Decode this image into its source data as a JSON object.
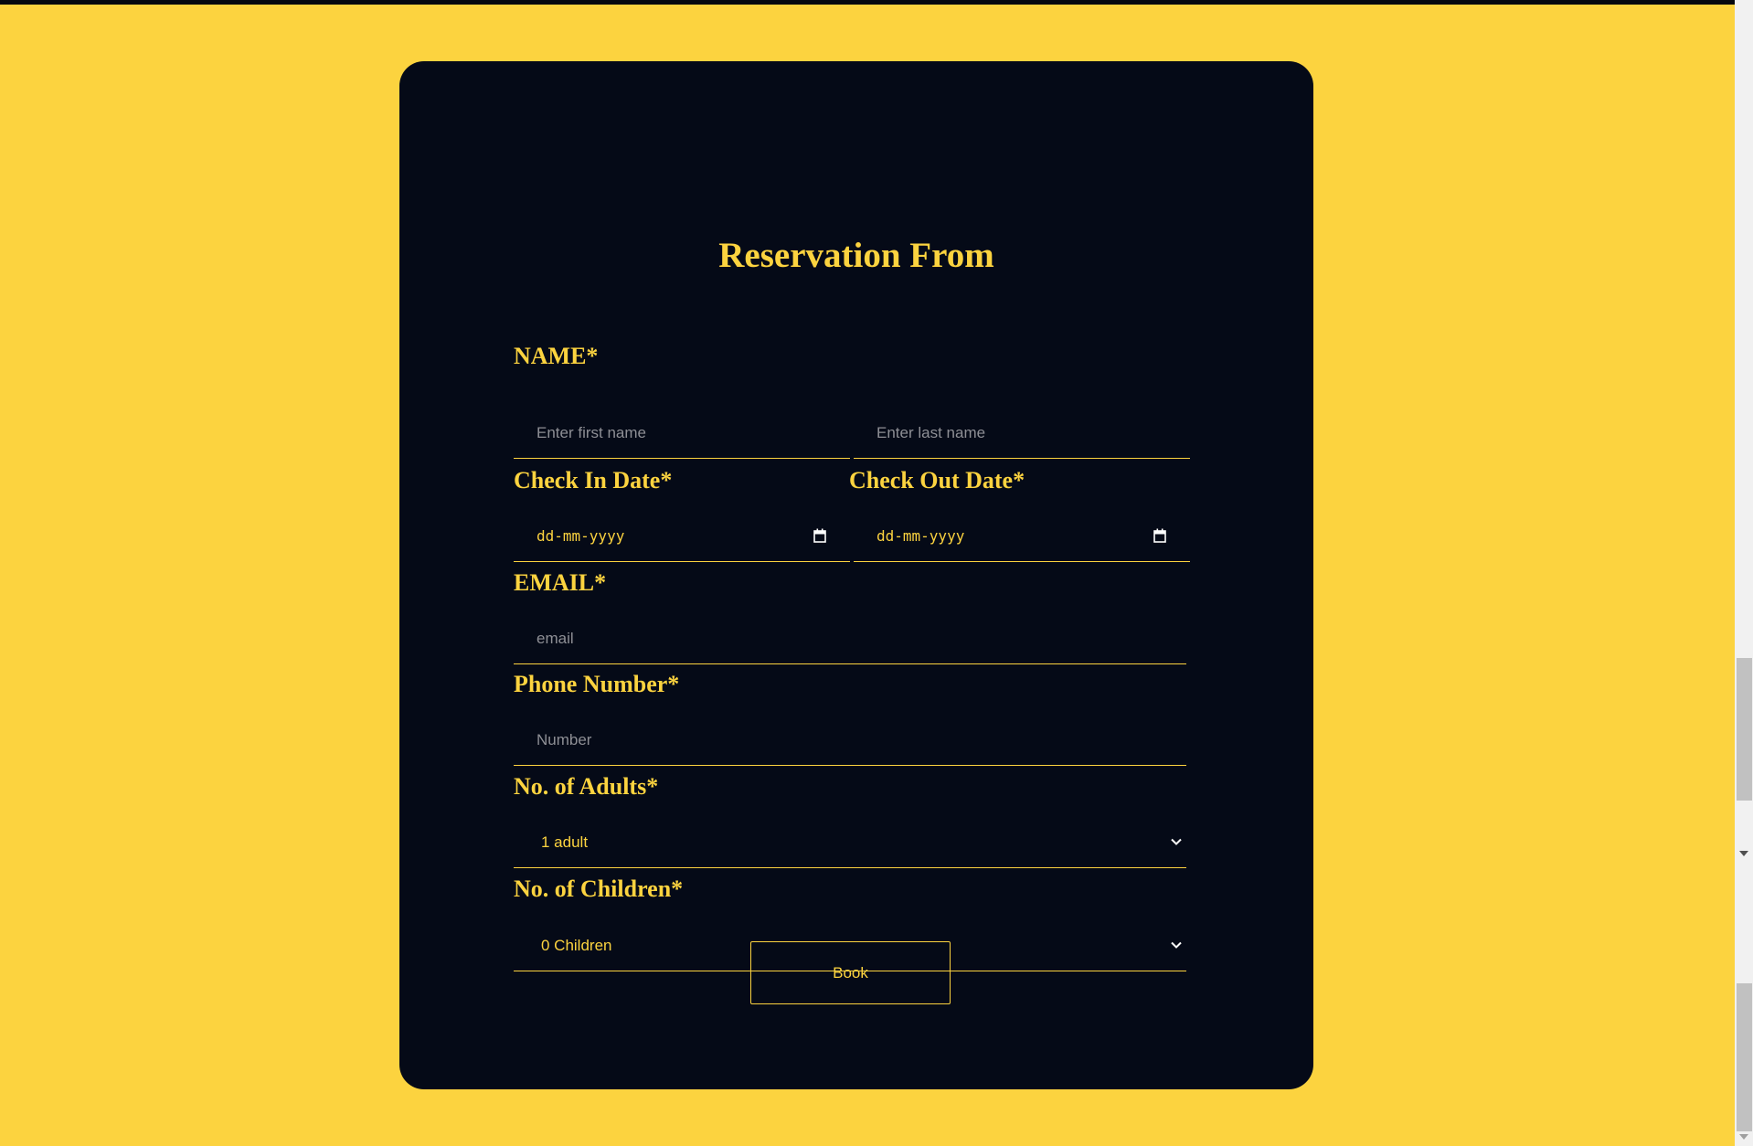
{
  "form": {
    "title": "Reservation From",
    "name_label": "NAME*",
    "first_name_placeholder": "Enter first name",
    "last_name_placeholder": "Enter last name",
    "check_in_label": "Check In Date*",
    "check_out_label": "Check Out Date*",
    "check_in_value": "dd-mm-yyyy",
    "check_out_value": "dd-mm-yyyy",
    "email_label": "EMAIL*",
    "email_placeholder": "email",
    "phone_label": "Phone Number*",
    "phone_placeholder": "Number",
    "adults_label": "No. of Adults*",
    "adults_value": "1 adult",
    "children_label": "No. of Children*",
    "children_value": "0 Children",
    "book_label": "Book"
  },
  "icons": {
    "date": "calendar-icon",
    "select": "chevron-down-icon"
  },
  "colors": {
    "page_background": "#fcd33f",
    "card_background": "#050a17",
    "accent": "#fcd33f",
    "placeholder": "#8e8f95"
  }
}
